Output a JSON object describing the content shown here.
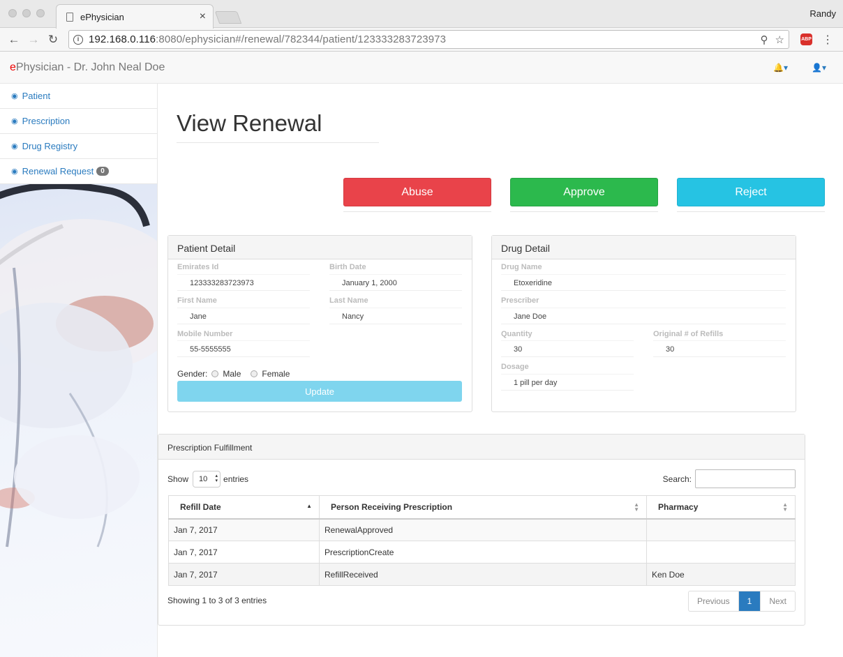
{
  "browser": {
    "tab_title": "ePhysician",
    "user_name": "Randy",
    "url_host": "192.168.0.116",
    "url_rest": ":8080/ephysician#/renewal/782344/patient/123333283723973",
    "abp_label": "ABP"
  },
  "navbar": {
    "brand_e": "e",
    "brand_rest": "Physician - Dr. John Neal Doe"
  },
  "sidebar": {
    "items": [
      {
        "label": "Patient"
      },
      {
        "label": "Prescription"
      },
      {
        "label": "Drug Registry"
      },
      {
        "label": "Renewal Request",
        "badge": "0"
      }
    ]
  },
  "page": {
    "title": "View Renewal",
    "abuse_label": "Abuse",
    "approve_label": "Approve",
    "reject_label": "Reject"
  },
  "patient": {
    "header": "Patient Detail",
    "emirates_label": "Emirates Id",
    "emirates_value": "123333283723973",
    "birth_label": "Birth Date",
    "birth_value": "January 1, 2000",
    "first_label": "First Name",
    "first_value": "Jane",
    "last_label": "Last Name",
    "last_value": "Nancy",
    "mobile_label": "Mobile Number",
    "mobile_value": "55-5555555",
    "gender_label": "Gender:",
    "male_label": "Male",
    "female_label": "Female",
    "update_label": "Update"
  },
  "drug": {
    "header": "Drug Detail",
    "name_label": "Drug Name",
    "name_value": "Etoxeridine",
    "prescriber_label": "Prescriber",
    "prescriber_value": "Jane Doe",
    "quantity_label": "Quantity",
    "quantity_value": "30",
    "refills_label": "Original # of Refills",
    "refills_value": "30",
    "dosage_label": "Dosage",
    "dosage_value": "1 pill per day"
  },
  "fulfillment": {
    "header": "Prescription Fulfillment",
    "show_label": "Show",
    "entries_value": "10",
    "entries_label": "entries",
    "search_label": "Search:",
    "columns": [
      "Refill Date",
      "Person Receiving Prescription",
      "Pharmacy"
    ],
    "rows": [
      [
        "Jan 7, 2017",
        "RenewalApproved",
        ""
      ],
      [
        "Jan 7, 2017",
        "PrescriptionCreate",
        ""
      ],
      [
        "Jan 7, 2017",
        "RefillReceived",
        "Ken Doe"
      ]
    ],
    "info": "Showing 1 to 3 of 3 entries",
    "prev_label": "Previous",
    "page_label": "1",
    "next_label": "Next"
  }
}
